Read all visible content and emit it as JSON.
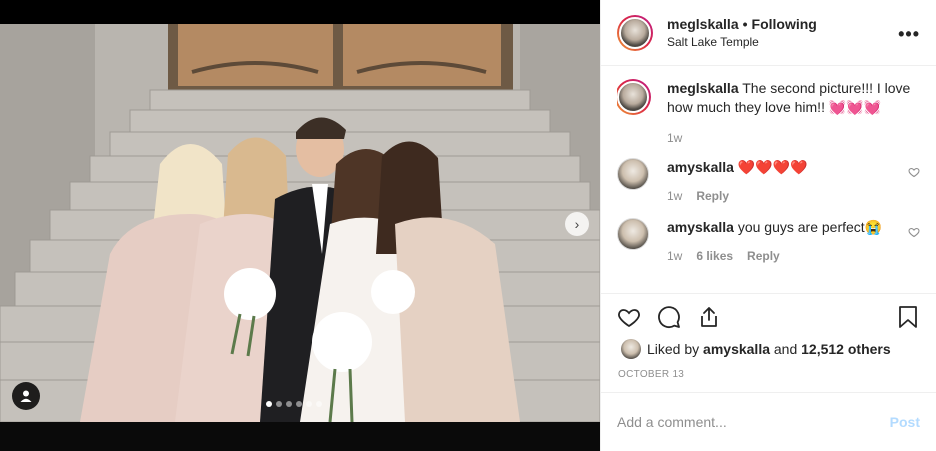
{
  "post": {
    "username": "meglskalla",
    "separator": "•",
    "follow_status": "Following",
    "location": "Salt Lake Temple",
    "more_icon": "more-horizontal-icon"
  },
  "caption": {
    "username": "meglskalla",
    "text": "The second picture!!! I love how much they love him!! 💓💓💓",
    "time": "1w"
  },
  "comments": [
    {
      "username": "amyskalla",
      "text": "❤️❤️❤️❤️",
      "time": "1w",
      "reply_label": "Reply",
      "likes_label": ""
    },
    {
      "username": "amyskalla",
      "text": "you guys are perfect😭",
      "time": "1w",
      "reply_label": "Reply",
      "likes_label": "6 likes"
    }
  ],
  "actions": {
    "like_icon": "heart-icon",
    "comment_icon": "comment-icon",
    "share_icon": "share-icon",
    "save_icon": "bookmark-icon"
  },
  "likes": {
    "prefix": "Liked by",
    "user": "amyskalla",
    "conjunction": "and",
    "others": "12,512 others"
  },
  "date": "OCTOBER 13",
  "add_comment": {
    "placeholder": "Add a comment...",
    "post_label": "Post"
  },
  "carousel": {
    "total": 6,
    "active_index": 0,
    "next_icon": "chevron-right-icon",
    "tag_icon": "user-tag-icon"
  },
  "colors": {
    "link_disabled": "#b3dbff",
    "muted": "#8e8e8e",
    "text": "#262626"
  }
}
